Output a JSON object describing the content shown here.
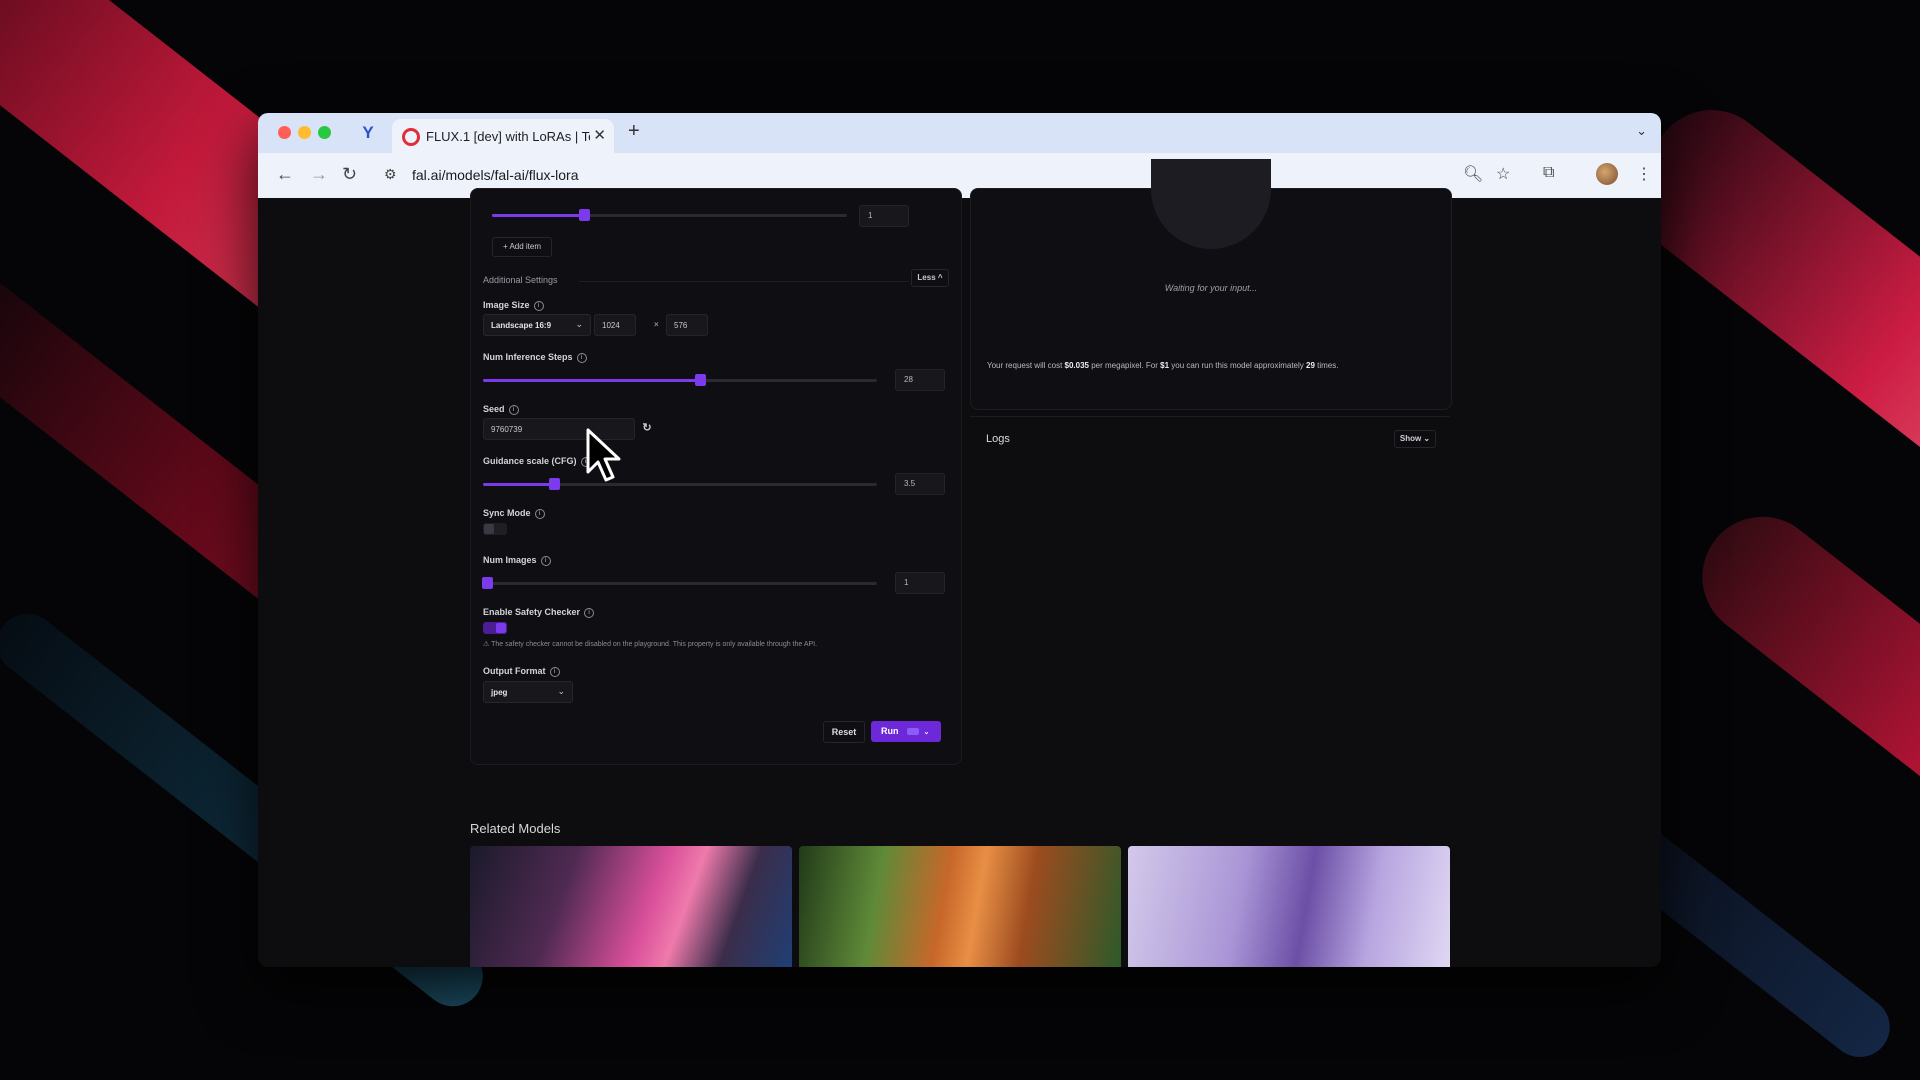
{
  "browser": {
    "tab_title": "FLUX.1 [dev] with LoRAs | Te",
    "url": "fal.ai/models/fal-ai/flux-lora"
  },
  "form": {
    "lora_scale_value": "1",
    "lora_scale_fraction": 0.26,
    "add_item": "Add item",
    "additional_settings": "Additional Settings",
    "less_toggle": "Less ^",
    "image_size": {
      "label": "Image Size",
      "selected": "Landscape 16:9",
      "width": "1024",
      "times": "×",
      "height": "576"
    },
    "num_inference_steps": {
      "label": "Num Inference Steps",
      "value": "28",
      "fraction": 0.55
    },
    "seed": {
      "label": "Seed",
      "value": "9760739"
    },
    "guidance_scale": {
      "label": "Guidance scale (CFG)",
      "value": "3.5",
      "fraction": 0.18
    },
    "sync_mode": {
      "label": "Sync Mode",
      "enabled": false
    },
    "num_images": {
      "label": "Num Images",
      "value": "1",
      "fraction": 0.01
    },
    "safety_checker": {
      "label": "Enable Safety Checker",
      "enabled": true,
      "note": "The safety checker cannot be disabled on the playground. This property is only available through the API."
    },
    "output_format": {
      "label": "Output Format",
      "selected": "jpeg"
    },
    "reset_label": "Reset",
    "run_label": "Run"
  },
  "output": {
    "waiting": "Waiting for your input...",
    "cost_prefix": "Your request will cost ",
    "cost_value": "$0.035",
    "cost_mid": " per megapixel. For ",
    "cost_dollar": "$1",
    "cost_mid2": " you can run this model approximately ",
    "cost_times": "29",
    "cost_suffix": " times.",
    "logs_title": "Logs",
    "logs_toggle": "Show"
  },
  "related": {
    "title": "Related Models"
  },
  "colors": {
    "accent": "#7c3aed",
    "background": "#0d0d10"
  }
}
